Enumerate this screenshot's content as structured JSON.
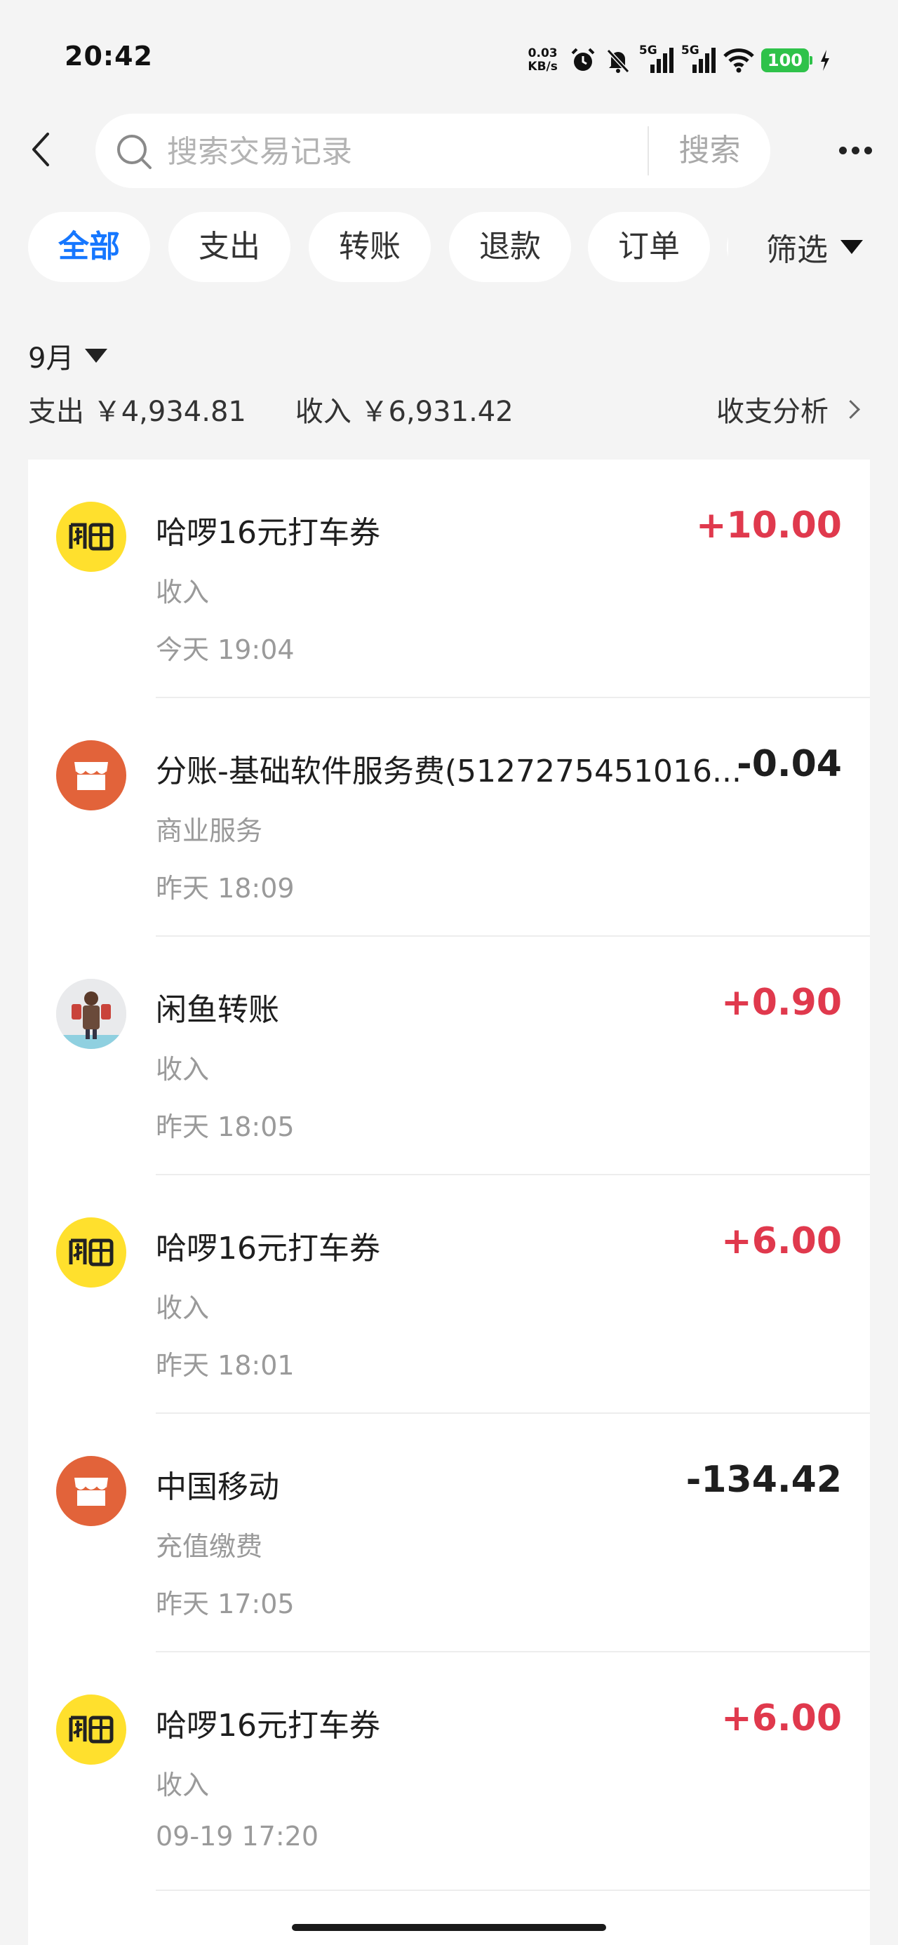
{
  "status_bar": {
    "time": "20:42",
    "net_speed_value": "0.03",
    "net_speed_unit": "KB/s",
    "signal_1_label": "5G",
    "signal_2_label": "5G",
    "battery": "100",
    "icons": [
      "alarm-icon",
      "mute-icon",
      "signal-icon",
      "wifi-icon",
      "battery-icon",
      "charging-icon"
    ]
  },
  "header": {
    "back_icon": "back-arrow-icon",
    "search_placeholder": "搜索交易记录",
    "search_button": "搜索",
    "more_icon": "more-icon"
  },
  "filters": {
    "chips": [
      "全部",
      "支出",
      "转账",
      "退款",
      "订单"
    ],
    "active_index": 0,
    "filter_button": "筛选"
  },
  "summary": {
    "month": "9月",
    "expense": "支出 ￥4,934.81",
    "income": "收入 ￥6,931.42",
    "analysis": "收支分析"
  },
  "colors": {
    "accent": "#1677ff",
    "income": "#e0394d",
    "expense": "#1e1e1e",
    "xianyu_yellow": "#ffe02d",
    "shop_orange": "#e2633a",
    "battery_green": "#2fc24a"
  },
  "transactions": [
    {
      "title": "哈啰16元打车券",
      "category": "收入",
      "time": "今天 19:04",
      "amount": "+10.00",
      "avatar": "xianyu-logo-icon"
    },
    {
      "title": "分账-基础软件服务费(5127275451016...",
      "category": "商业服务",
      "time": "昨天 18:09",
      "amount": "-0.04",
      "avatar": "shop-icon"
    },
    {
      "title": "闲鱼转账",
      "category": "收入",
      "time": "昨天 18:05",
      "amount": "+0.90",
      "avatar": "user-avatar"
    },
    {
      "title": "哈啰16元打车券",
      "category": "收入",
      "time": "昨天 18:01",
      "amount": "+6.00",
      "avatar": "xianyu-logo-icon"
    },
    {
      "title": "中国移动",
      "category": "充值缴费",
      "time": "昨天 17:05",
      "amount": "-134.42",
      "avatar": "shop-icon"
    },
    {
      "title": "哈啰16元打车券",
      "category": "收入",
      "time": "09-19 17:20",
      "amount": "+6.00",
      "avatar": "xianyu-logo-icon"
    }
  ]
}
